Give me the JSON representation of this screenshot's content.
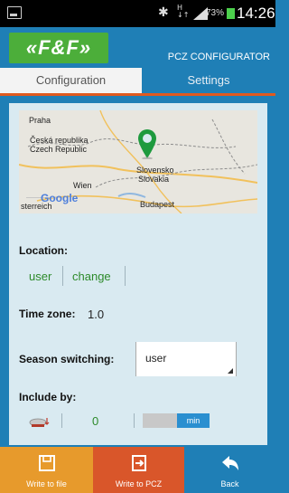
{
  "status_bar": {
    "data_label": "H\n↓↑",
    "battery_percent": "73%",
    "time": "14:26"
  },
  "header": {
    "logo_text": "«F&F»",
    "app_title": "PCZ CONFIGURATOR"
  },
  "tabs": [
    {
      "label": "Configuration",
      "active": true
    },
    {
      "label": "Settings",
      "active": false
    }
  ],
  "map": {
    "place_labels": {
      "praha": "Praha",
      "cesko": "Česká republika",
      "czech": "Czech Republic",
      "wien": "Wien",
      "slovensko": "Slovensko",
      "slovakia": "Slovakia",
      "budapest": "Budapest",
      "osterreich": "sterreich"
    },
    "google_logo": "Google"
  },
  "location": {
    "label": "Location:",
    "value": "user",
    "change_label": "change"
  },
  "time_zone": {
    "label": "Time zone:",
    "value": "1.0"
  },
  "season_switching": {
    "label": "Season switching:",
    "selected": "user"
  },
  "include_by": {
    "label": "Include by:",
    "value": "0",
    "toggle_label": "min"
  },
  "actions": {
    "write_file": "Write to file",
    "write_pcz": "Write to PCZ",
    "back": "Back"
  },
  "colors": {
    "brand_blue": "#1f7fb6",
    "accent_orange": "#e05a1e",
    "logo_green": "#4cae3a",
    "text_green": "#2d8a2a"
  }
}
